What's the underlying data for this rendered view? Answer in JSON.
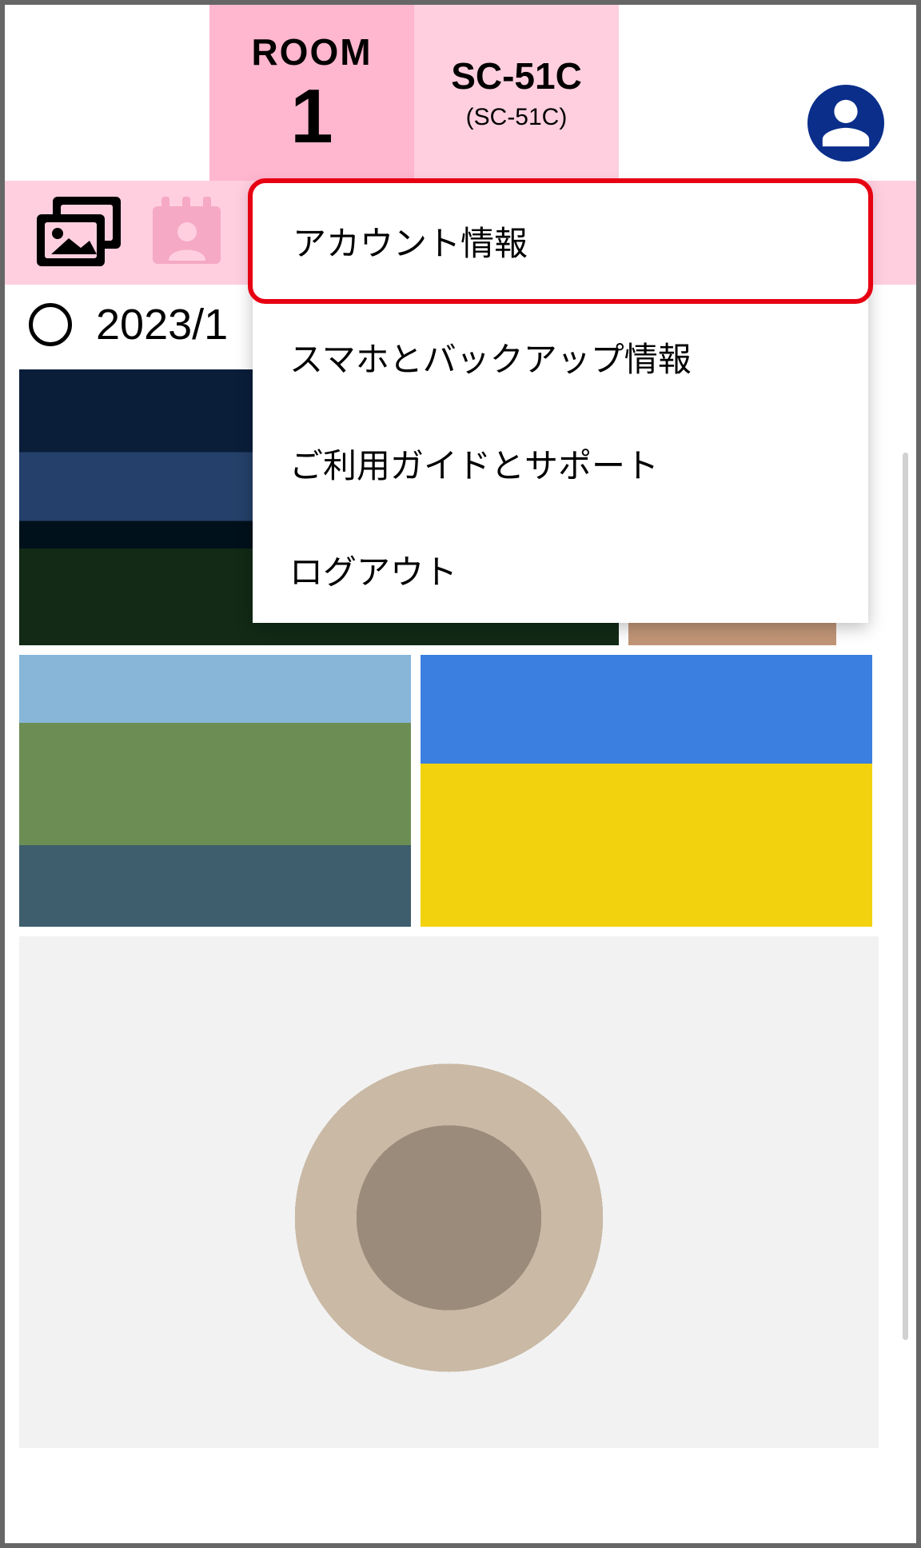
{
  "header": {
    "room_label": "ROOM",
    "room_number": "1",
    "device_name": "SC-51C",
    "device_sub": "(SC-51C)"
  },
  "toolbar": {
    "gallery_icon_name": "gallery-icon",
    "calendar_icon_name": "calendar-person-icon"
  },
  "date_section": {
    "date_text": "2023/1"
  },
  "menu": {
    "items": [
      {
        "label": "アカウント情報",
        "highlighted": true
      },
      {
        "label": "スマホとバックアップ情報",
        "highlighted": false
      },
      {
        "label": "ご利用ガイドとサポート",
        "highlighted": false
      },
      {
        "label": "ログアウト",
        "highlighted": false
      }
    ]
  },
  "avatar": {
    "icon_name": "person-icon"
  }
}
